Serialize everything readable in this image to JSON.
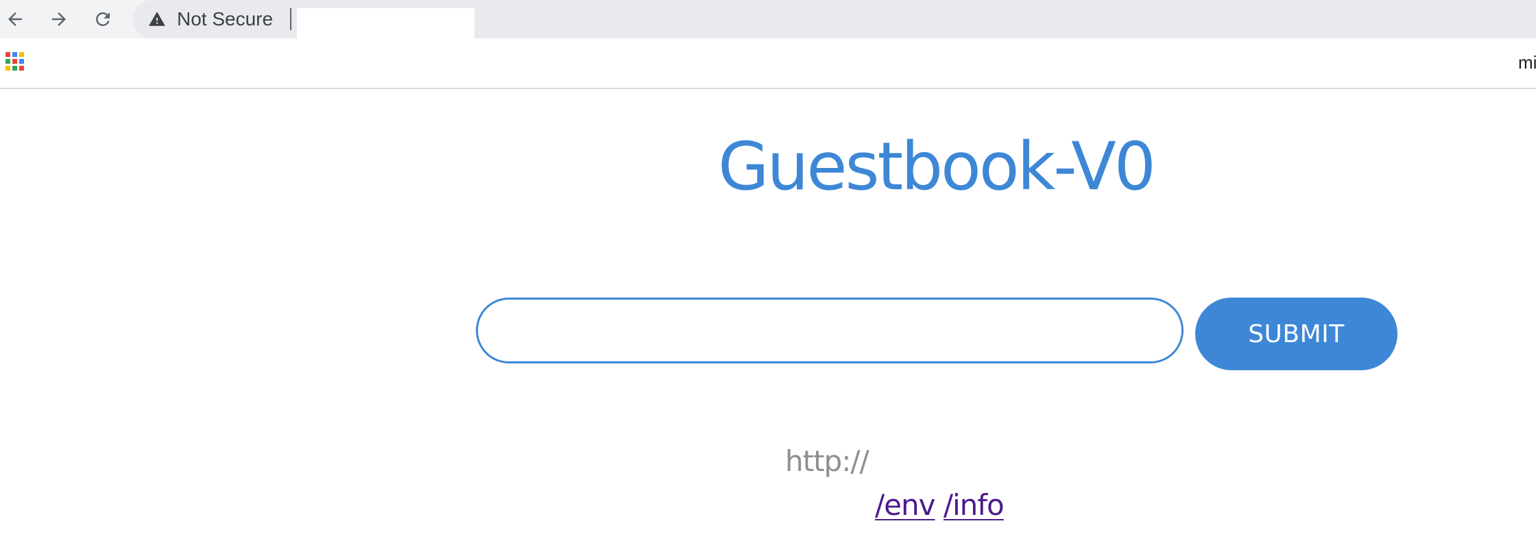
{
  "browser": {
    "security_label": "Not Secure",
    "url_value": "",
    "bookmarks": [
      "mi"
    ]
  },
  "colors": {
    "accent": "#3d87d6",
    "link_visited": "#4b1a8c",
    "muted_text": "#8f8f8f"
  },
  "icons": {
    "back": "arrow-left-icon",
    "forward": "arrow-right-icon",
    "reload": "reload-icon",
    "security": "warning-triangle-icon",
    "apps": "apps-grid-icon"
  },
  "page": {
    "title": "Guestbook-V0",
    "input_value": "",
    "submit_label": "SUBMIT",
    "host_text": "http://",
    "links": [
      {
        "label": "/env"
      },
      {
        "label": "/info"
      }
    ]
  }
}
